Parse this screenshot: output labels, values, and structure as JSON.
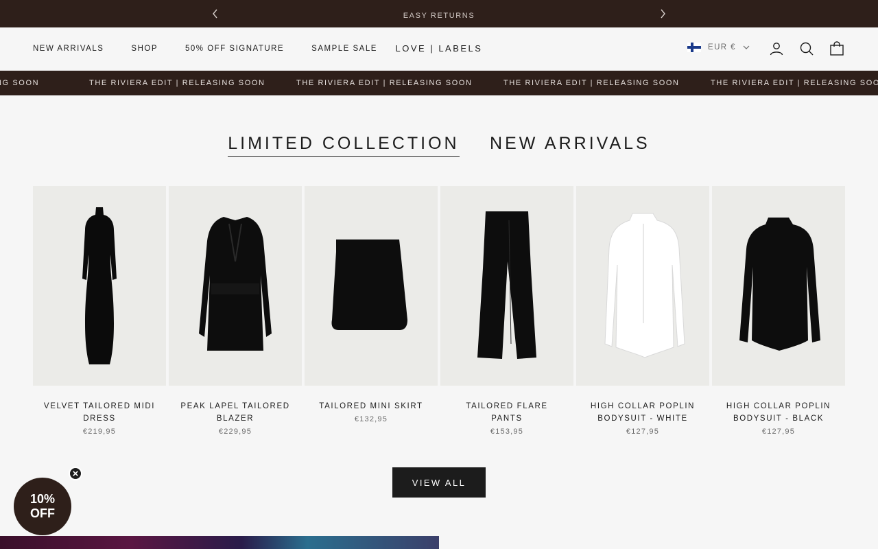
{
  "announcement": {
    "text": "EASY RETURNS"
  },
  "nav": {
    "items": [
      "NEW ARRIVALS",
      "SHOP",
      "50% OFF SIGNATURE",
      "SAMPLE SALE"
    ]
  },
  "logo": "LOVE | LABELS",
  "currency": {
    "label": "EUR €"
  },
  "marquee": {
    "items": [
      "NG SOON",
      "THE RIVIERA EDIT | RELEASING SOON",
      "THE RIVIERA EDIT | RELEASING SOON",
      "THE RIVIERA EDIT | RELEASING SOON",
      "THE RIVIERA EDIT | RELEASING SOON"
    ]
  },
  "tabs": {
    "items": [
      "LIMITED COLLECTION",
      "NEW ARRIVALS"
    ],
    "active": 0
  },
  "products": [
    {
      "title": "VELVET TAILORED MIDI DRESS",
      "price": "€219,95"
    },
    {
      "title": "PEAK LAPEL TAILORED BLAZER",
      "price": "€229,95"
    },
    {
      "title": "TAILORED MINI SKIRT",
      "price": "€132,95"
    },
    {
      "title": "TAILORED FLARE PANTS",
      "price": "€153,95"
    },
    {
      "title": "HIGH COLLAR POPLIN BODYSUIT - WHITE",
      "price": "€127,95"
    },
    {
      "title": "HIGH COLLAR POPLIN BODYSUIT - BLACK",
      "price": "€127,95"
    }
  ],
  "view_all": "VIEW ALL",
  "promo": {
    "line1": "10%",
    "line2": "OFF"
  },
  "colors": {
    "brand_dark": "#2e1f1a",
    "text": "#1c1c1c",
    "background": "#f6f6f6"
  },
  "icons": [
    "chevron-left-icon",
    "chevron-right-icon",
    "finland-flag-icon",
    "chevron-down-icon",
    "account-icon",
    "search-icon",
    "bag-icon",
    "close-icon"
  ]
}
